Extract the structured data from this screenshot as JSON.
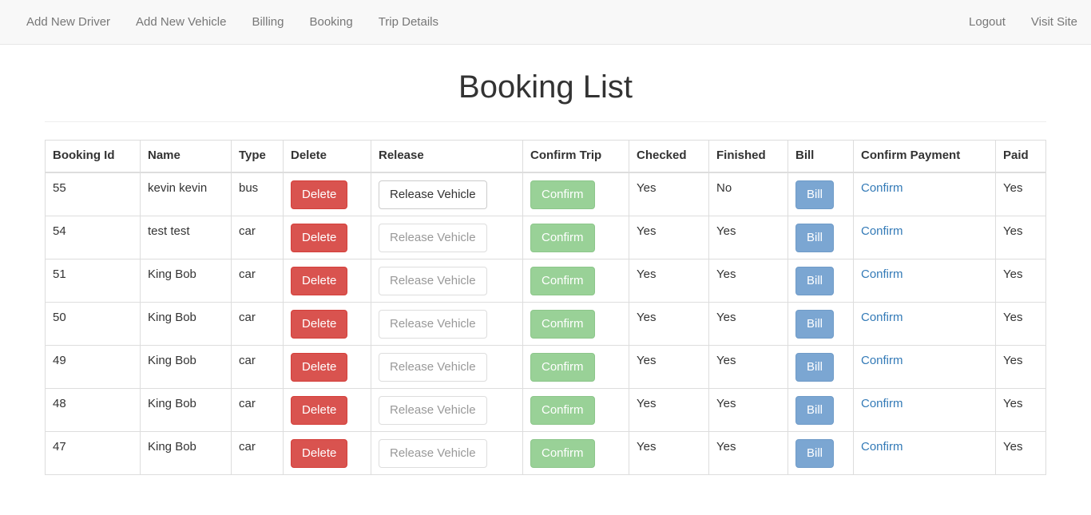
{
  "nav": {
    "left": [
      "Add New Driver",
      "Add New Vehicle",
      "Billing",
      "Booking",
      "Trip Details"
    ],
    "right": [
      "Logout",
      "Visit Site"
    ]
  },
  "page": {
    "title": "Booking List"
  },
  "table": {
    "headers": [
      "Booking Id",
      "Name",
      "Type",
      "Delete",
      "Release",
      "Confirm Trip",
      "Checked",
      "Finished",
      "Bill",
      "Confirm Payment",
      "Paid"
    ],
    "labels": {
      "delete": "Delete",
      "release": "Release Vehicle",
      "confirm_trip": "Confirm",
      "bill": "Bill",
      "confirm_payment": "Confirm"
    },
    "rows": [
      {
        "id": "55",
        "name": "kevin kevin",
        "type": "bus",
        "checked": "Yes",
        "finished": "No",
        "paid": "Yes"
      },
      {
        "id": "54",
        "name": "test test",
        "type": "car",
        "checked": "Yes",
        "finished": "Yes",
        "paid": "Yes"
      },
      {
        "id": "51",
        "name": "King Bob",
        "type": "car",
        "checked": "Yes",
        "finished": "Yes",
        "paid": "Yes"
      },
      {
        "id": "50",
        "name": "King Bob",
        "type": "car",
        "checked": "Yes",
        "finished": "Yes",
        "paid": "Yes"
      },
      {
        "id": "49",
        "name": "King Bob",
        "type": "car",
        "checked": "Yes",
        "finished": "Yes",
        "paid": "Yes"
      },
      {
        "id": "48",
        "name": "King Bob",
        "type": "car",
        "checked": "Yes",
        "finished": "Yes",
        "paid": "Yes"
      },
      {
        "id": "47",
        "name": "King Bob",
        "type": "car",
        "checked": "Yes",
        "finished": "Yes",
        "paid": "Yes"
      }
    ]
  },
  "colors": {
    "danger": "#d9534f",
    "success": "#99d197",
    "primary": "#7ba6d2",
    "link": "#337ab7"
  }
}
